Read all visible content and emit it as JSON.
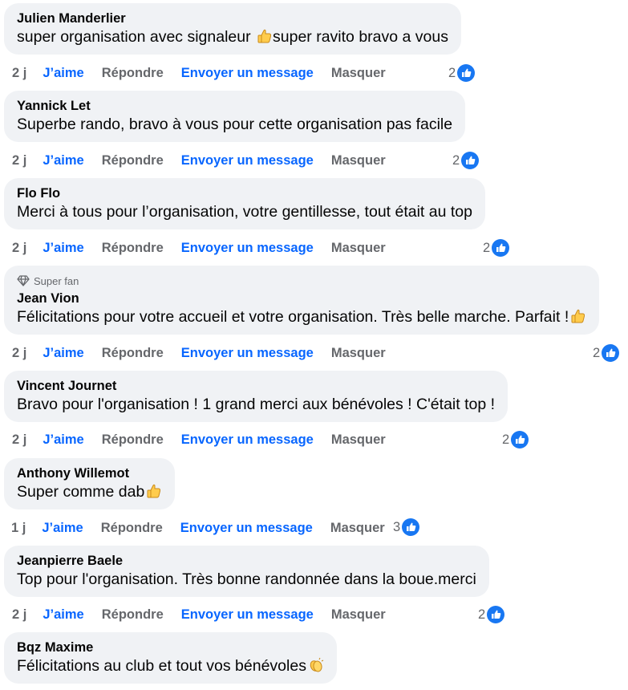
{
  "actions": {
    "like": "J’aime",
    "reply": "Répondre",
    "message": "Envoyer un message",
    "hide": "Masquer"
  },
  "comments": [
    {
      "author": "Julien Manderlier",
      "text_parts": [
        "super organisation avec signaleur ",
        "super ravito bravo a vous"
      ],
      "emoji": [
        "thumbs-up-icon"
      ],
      "time": "2 j",
      "reactions": "2",
      "badge": null
    },
    {
      "author": "Yannick Let",
      "text": "Superbe rando, bravo à vous pour cette organisation pas facile",
      "time": "2 j",
      "reactions": "2",
      "badge": null
    },
    {
      "author": "Flo Flo",
      "text": "Merci à tous pour l’organisation, votre gentillesse, tout était au top",
      "time": "2 j",
      "reactions": "2",
      "badge": null
    },
    {
      "author": "Jean Vion",
      "text": "Félicitations pour votre accueil et votre organisation. Très belle marche. Parfait !",
      "emoji": [
        "thumbs-up-icon"
      ],
      "time": "2 j",
      "reactions": "2",
      "badge": "Super fan"
    },
    {
      "author": "Vincent Journet",
      "text": "Bravo pour l'organisation ! 1 grand merci aux bénévoles ! C'était top !",
      "time": "2 j",
      "reactions": "2",
      "badge": null
    },
    {
      "author": "Anthony Willemot",
      "text": "Super comme dab",
      "emoji": [
        "thumbs-up-icon"
      ],
      "time": "1 j",
      "reactions": "3",
      "badge": null
    },
    {
      "author": "Jeanpierre Baele",
      "text": "Top pour l'organisation. Très bonne randonnée dans la boue.merci",
      "time": "2 j",
      "reactions": "2",
      "badge": null
    },
    {
      "author": "Bqz Maxime",
      "text": "Félicitations au club et tout vos bénévoles",
      "emoji": [
        "clapping-hands-icon"
      ],
      "time": null,
      "reactions": null,
      "badge": null
    }
  ],
  "colors": {
    "bubble": "#f0f2f5",
    "link": "#0866ff",
    "muted": "#65676b",
    "like_icon": "#1877f2"
  }
}
